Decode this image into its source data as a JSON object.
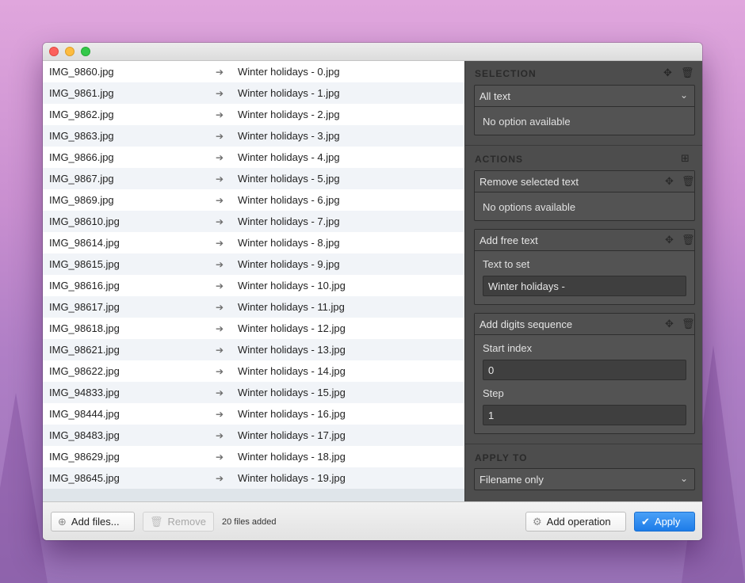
{
  "files": [
    {
      "original": "IMG_9860.jpg",
      "renamed": "Winter holidays - 0.jpg"
    },
    {
      "original": "IMG_9861.jpg",
      "renamed": "Winter holidays - 1.jpg"
    },
    {
      "original": "IMG_9862.jpg",
      "renamed": "Winter holidays - 2.jpg"
    },
    {
      "original": "IMG_9863.jpg",
      "renamed": "Winter holidays - 3.jpg"
    },
    {
      "original": "IMG_9866.jpg",
      "renamed": "Winter holidays - 4.jpg"
    },
    {
      "original": "IMG_9867.jpg",
      "renamed": "Winter holidays - 5.jpg"
    },
    {
      "original": "IMG_9869.jpg",
      "renamed": "Winter holidays - 6.jpg"
    },
    {
      "original": "IMG_98610.jpg",
      "renamed": "Winter holidays - 7.jpg"
    },
    {
      "original": "IMG_98614.jpg",
      "renamed": "Winter holidays - 8.jpg"
    },
    {
      "original": "IMG_98615.jpg",
      "renamed": "Winter holidays - 9.jpg"
    },
    {
      "original": "IMG_98616.jpg",
      "renamed": "Winter holidays - 10.jpg"
    },
    {
      "original": "IMG_98617.jpg",
      "renamed": "Winter holidays - 11.jpg"
    },
    {
      "original": "IMG_98618.jpg",
      "renamed": "Winter holidays - 12.jpg"
    },
    {
      "original": "IMG_98621.jpg",
      "renamed": "Winter holidays - 13.jpg"
    },
    {
      "original": "IMG_98622.jpg",
      "renamed": "Winter holidays - 14.jpg"
    },
    {
      "original": "IMG_94833.jpg",
      "renamed": "Winter holidays - 15.jpg"
    },
    {
      "original": "IMG_98444.jpg",
      "renamed": "Winter holidays - 16.jpg"
    },
    {
      "original": "IMG_98483.jpg",
      "renamed": "Winter holidays - 17.jpg"
    },
    {
      "original": "IMG_98629.jpg",
      "renamed": "Winter holidays - 18.jpg"
    },
    {
      "original": "IMG_98645.jpg",
      "renamed": "Winter holidays - 19.jpg"
    }
  ],
  "panel": {
    "selection": {
      "title": "SELECTION",
      "value": "All text",
      "note": "No option available"
    },
    "actions": {
      "title": "ACTIONS",
      "remove_text": {
        "title": "Remove selected text",
        "note": "No options available"
      },
      "free_text": {
        "title": "Add free text",
        "label": "Text to set",
        "value": "Winter holidays -"
      },
      "digits": {
        "title": "Add digits sequence",
        "start_label": "Start index",
        "start_value": "0",
        "step_label": "Step",
        "step_value": "1"
      }
    },
    "apply_to": {
      "title": "APPLY TO",
      "value": "Filename only"
    }
  },
  "footer": {
    "add_files": "Add files...",
    "remove": "Remove",
    "status": "20 files added",
    "add_operation": "Add operation",
    "apply": "Apply"
  }
}
